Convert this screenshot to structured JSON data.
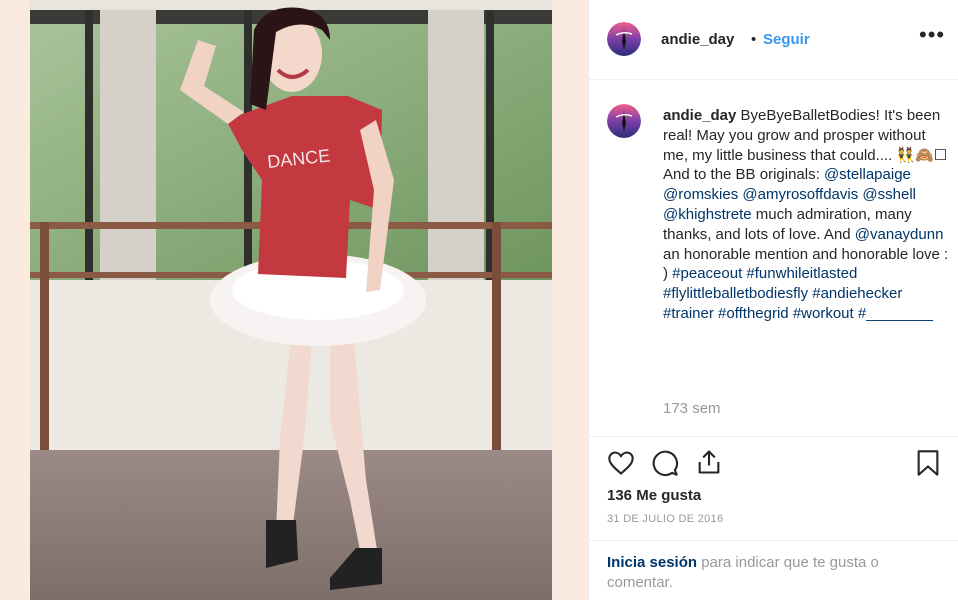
{
  "colors": {
    "link": "#003569",
    "follow": "#3897f0",
    "muted": "#999999"
  },
  "header": {
    "username": "andie_day",
    "separator": "•",
    "follow_label": "Seguir",
    "more_icon": "more-options-icon"
  },
  "caption": {
    "username": "andie_day",
    "text_1": "ByeByeBalletBodies! It's been real! May you grow and prosper without me, my little business that could.... 👯🙈☐ And to the BB originals: ",
    "mention_1": "@stellapaige",
    "mention_2": "@romskies",
    "mention_3": "@amyrosoffdavis",
    "mention_4": "@sshell",
    "mention_5": "@khighstrete",
    "text_2": " much admiration, many thanks, and lots of love. And ",
    "mention_6": "@vanaydunn",
    "text_3": " an honorable mention and honorable love : ) ",
    "tag_1": "#peaceout",
    "tag_2": "#funwhileitlasted",
    "tag_3": "#flylittleballetbodiesfly",
    "tag_4": "#andiehecker",
    "tag_5": "#trainer",
    "tag_6": "#offthegrid",
    "tag_7": "#workout",
    "tag_8": "#________",
    "age": "173 sem"
  },
  "actions": {
    "like_icon": "heart-icon",
    "comment_icon": "comment-icon",
    "share_icon": "share-icon",
    "save_icon": "bookmark-icon",
    "likes_text": "136 Me gusta",
    "date": "31 DE JULIO DE 2016"
  },
  "footer": {
    "login_link": "Inicia sesión",
    "login_rest": " para indicar que te gusta o comentar."
  }
}
